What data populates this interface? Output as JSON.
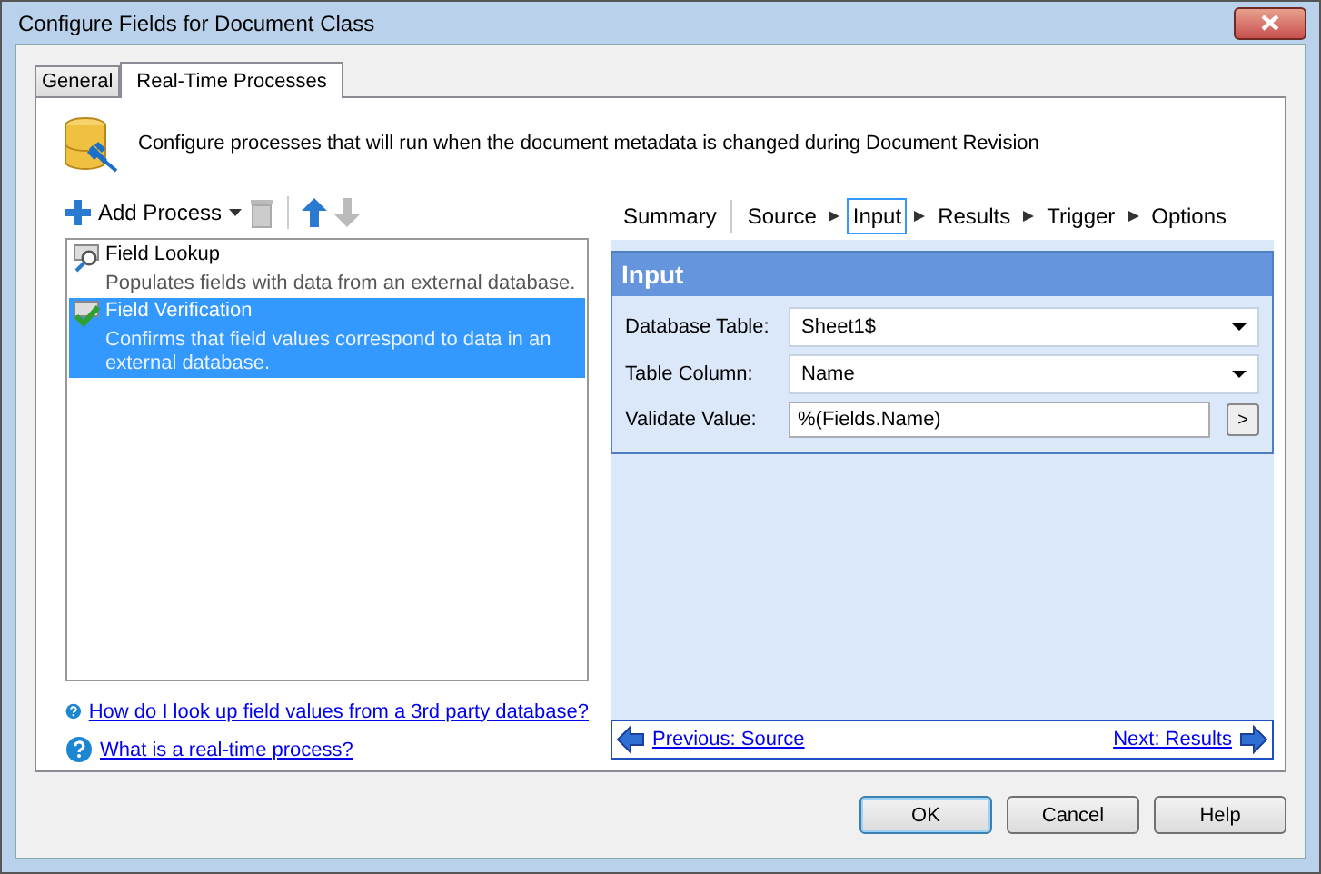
{
  "window": {
    "title": "Configure Fields for Document Class"
  },
  "tabs": [
    {
      "label": "General",
      "selected": false
    },
    {
      "label": "Real-Time Processes",
      "selected": true
    }
  ],
  "header": {
    "text": "Configure processes that will run when the document metadata is changed during Document Revision"
  },
  "toolbar": {
    "add_label": "Add Process"
  },
  "processes": [
    {
      "kind": "lookup",
      "name": "Field Lookup",
      "description": "Populates fields with data from an external database.",
      "selected": false
    },
    {
      "kind": "verification",
      "name": "Field Verification",
      "description": "Confirms that field values correspond to data in an external database.",
      "selected": true
    }
  ],
  "help_links": [
    "How do I look up field values from a 3rd party database?",
    "What is a real-time process?"
  ],
  "steps": [
    {
      "label": "Summary",
      "selected": false
    },
    {
      "label": "Source",
      "selected": false
    },
    {
      "label": "Input",
      "selected": true
    },
    {
      "label": "Results",
      "selected": false
    },
    {
      "label": "Trigger",
      "selected": false
    },
    {
      "label": "Options",
      "selected": false
    }
  ],
  "section": {
    "title": "Input",
    "fields": [
      {
        "kind": "dropdown",
        "label": "Database Table:",
        "value": "Sheet1$"
      },
      {
        "kind": "dropdown",
        "label": "Table Column:",
        "value": "Name"
      },
      {
        "kind": "text",
        "label": "Validate Value:",
        "value": "%(Fields.Name)",
        "button": ">"
      }
    ]
  },
  "nav": {
    "previous": "Previous: Source",
    "next": "Next: Results"
  },
  "buttons": [
    {
      "label": "OK",
      "default": true
    },
    {
      "label": "Cancel",
      "default": false
    },
    {
      "label": "Help",
      "default": false
    }
  ]
}
